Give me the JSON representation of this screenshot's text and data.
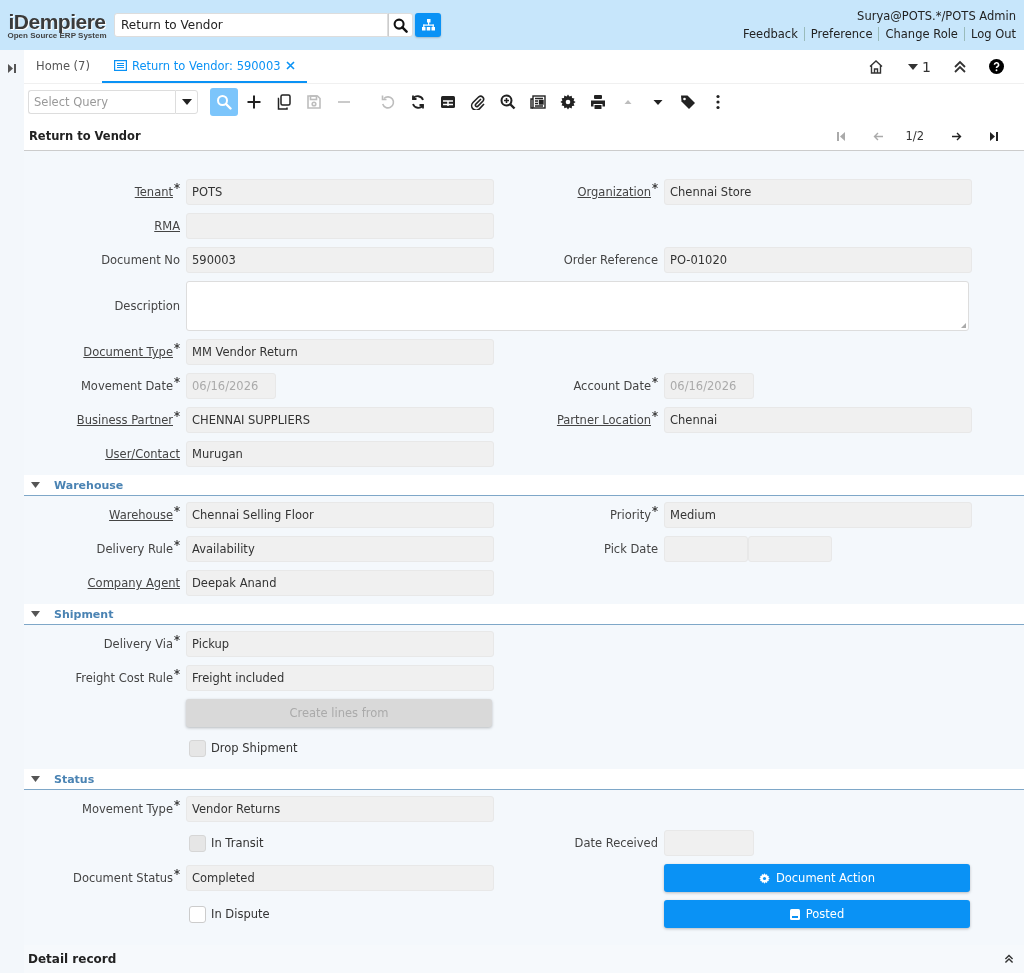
{
  "header": {
    "logo": "iDempiere",
    "logo_subtitle": "Open Source ERP System",
    "search": {
      "value": "Return to Vendor"
    },
    "user": "Surya@POTS.*/POTS Admin",
    "links": [
      "Feedback",
      "Preference",
      "Change Role",
      "Log Out"
    ]
  },
  "tabs": [
    {
      "label": "Home (7)",
      "selected": false,
      "closable": false
    },
    {
      "label": "Return to Vendor: 590003",
      "selected": true,
      "closable": true
    }
  ],
  "tab_tools": {
    "count": "1"
  },
  "query": {
    "placeholder": "Select Query"
  },
  "toolbar": [
    [
      {
        "kind": "search",
        "disabled": false,
        "selected": true
      },
      {
        "kind": "new",
        "disabled": false,
        "selected": false
      },
      {
        "kind": "copy",
        "disabled": false,
        "selected": false
      },
      {
        "kind": "save",
        "disabled": true,
        "selected": false
      },
      {
        "kind": "delete",
        "disabled": true,
        "selected": false
      }
    ],
    [
      {
        "kind": "undo",
        "disabled": true,
        "selected": false
      },
      {
        "kind": "refresh",
        "disabled": false,
        "selected": false
      },
      {
        "kind": "grid",
        "disabled": false,
        "selected": false
      },
      {
        "kind": "attach",
        "disabled": false,
        "selected": false
      },
      {
        "kind": "zoom",
        "disabled": false,
        "selected": false
      },
      {
        "kind": "report",
        "disabled": false,
        "selected": false
      },
      {
        "kind": "settings",
        "disabled": false,
        "selected": false
      },
      {
        "kind": "print",
        "disabled": false,
        "selected": false
      },
      {
        "kind": "up",
        "disabled": true,
        "selected": false
      },
      {
        "kind": "down",
        "disabled": false,
        "selected": false
      },
      {
        "kind": "tag",
        "disabled": false,
        "selected": false
      },
      {
        "kind": "more",
        "disabled": false,
        "selected": false
      }
    ]
  ],
  "title": "Return to Vendor",
  "record_nav": {
    "position": "1/2",
    "first_disabled": true,
    "prev_disabled": true,
    "next_disabled": false,
    "last_disabled": false
  },
  "sections": [
    {
      "rows": [
        {
          "left": {
            "kind": "text",
            "label": "Tenant",
            "link": true,
            "required": true,
            "value": "POTS"
          },
          "right": {
            "kind": "text",
            "label": "Organization",
            "link": true,
            "required": true,
            "value": "Chennai Store"
          }
        },
        {
          "left": {
            "kind": "text",
            "label": "RMA",
            "link": true,
            "required": false
          }
        },
        {
          "left": {
            "kind": "text",
            "label": "Document No",
            "link": false,
            "required": false,
            "value": "590003"
          },
          "right": {
            "kind": "text",
            "label": "Order Reference",
            "link": false,
            "required": false,
            "value": "PO-01020"
          }
        },
        {
          "left": {
            "kind": "textarea",
            "label": "Description",
            "link": false,
            "required": false
          }
        },
        {
          "left": {
            "kind": "text",
            "label": "Document Type",
            "link": true,
            "required": true,
            "value": "MM Vendor Return"
          }
        },
        {
          "left": {
            "kind": "date",
            "label": "Movement Date",
            "link": false,
            "required": true,
            "value": "06/16/2026"
          },
          "right": {
            "kind": "date",
            "label": "Account Date",
            "link": false,
            "required": true,
            "value": "06/16/2026"
          }
        },
        {
          "left": {
            "kind": "text",
            "label": "Business Partner",
            "link": true,
            "required": true,
            "value": "CHENNAI SUPPLIERS"
          },
          "right": {
            "kind": "text",
            "label": "Partner Location",
            "link": true,
            "required": true,
            "value": "Chennai"
          }
        },
        {
          "left": {
            "kind": "text",
            "label": "User/Contact",
            "link": true,
            "required": false,
            "value": "Murugan"
          }
        }
      ]
    },
    {
      "title": "Warehouse",
      "expanded": true,
      "rows": [
        {
          "left": {
            "kind": "text",
            "label": "Warehouse",
            "link": true,
            "required": true,
            "value": "Chennai Selling Floor"
          },
          "right": {
            "kind": "text",
            "label": "Priority",
            "link": false,
            "required": true,
            "value": "Medium"
          }
        },
        {
          "left": {
            "kind": "text",
            "label": "Delivery Rule",
            "link": false,
            "required": true,
            "value": "Availability"
          },
          "right": {
            "kind": "datetime",
            "label": "Pick Date",
            "link": false,
            "required": false
          }
        },
        {
          "left": {
            "kind": "text",
            "label": "Company Agent",
            "link": true,
            "required": false,
            "value": "Deepak Anand"
          }
        }
      ]
    },
    {
      "title": "Shipment",
      "expanded": true,
      "rows": [
        {
          "left": {
            "kind": "text",
            "label": "Delivery Via",
            "link": false,
            "required": true,
            "value": "Pickup"
          }
        },
        {
          "left": {
            "kind": "text",
            "label": "Freight Cost Rule",
            "link": false,
            "required": true,
            "value": "Freight included"
          }
        },
        {
          "left": {
            "kind": "button",
            "label": "Create lines from",
            "disabled": true
          }
        },
        {
          "left": {
            "kind": "checkbox",
            "label": "Drop Shipment",
            "checked": false,
            "disabled": true
          }
        }
      ]
    },
    {
      "title": "Status",
      "expanded": true,
      "rows": [
        {
          "left": {
            "kind": "text",
            "label": "Movement Type",
            "link": false,
            "required": true,
            "value": "Vendor Returns"
          }
        },
        {
          "left": {
            "kind": "checkbox",
            "label": "In Transit",
            "checked": false,
            "disabled": true
          },
          "right": {
            "kind": "date",
            "label": "Date Received",
            "link": false,
            "required": false
          }
        },
        {
          "left": {
            "kind": "text",
            "label": "Document Status",
            "link": false,
            "required": true,
            "value": "Completed"
          },
          "right": {
            "kind": "button",
            "label": "Document Action",
            "disabled": false
          }
        },
        {
          "left": {
            "kind": "checkbox",
            "label": "In Dispute",
            "checked": false,
            "disabled": false
          },
          "right": {
            "kind": "button",
            "label": "Posted",
            "disabled": false
          }
        }
      ]
    }
  ],
  "detail": {
    "title": "Detail record"
  }
}
